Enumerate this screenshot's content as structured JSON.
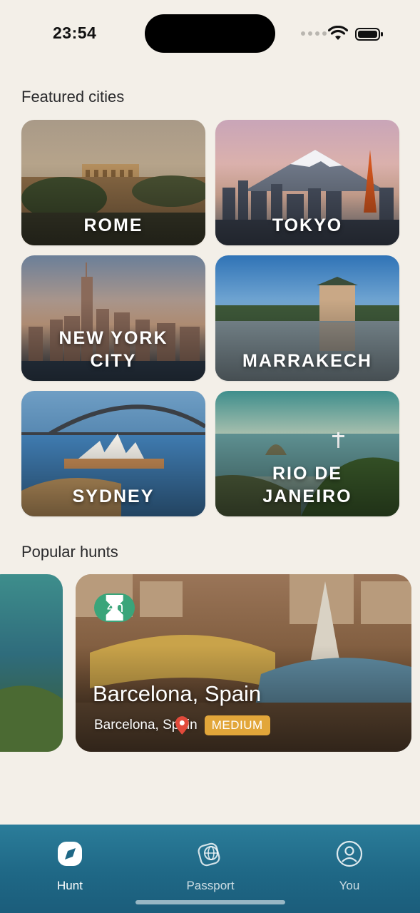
{
  "status": {
    "time": "23:54"
  },
  "sections": {
    "featured": "Featured cities",
    "popular": "Popular hunts"
  },
  "cities": [
    {
      "name": "ROME"
    },
    {
      "name": "TOKYO"
    },
    {
      "name": "NEW YORK CITY"
    },
    {
      "name": "MARRAKECH"
    },
    {
      "name": "SYDNEY"
    },
    {
      "name": "RIO DE JANEIRO"
    }
  ],
  "hunt": {
    "duration": "4h",
    "title": "Barcelona, Spain",
    "location": "Barcelona, Spain",
    "difficulty": "MEDIUM"
  },
  "tabs": [
    {
      "label": "Hunt",
      "icon": "compass-icon",
      "active": true
    },
    {
      "label": "Passport",
      "icon": "passport-globe-icon",
      "active": false
    },
    {
      "label": "You",
      "icon": "user-icon",
      "active": false
    }
  ],
  "colors": {
    "accent_green": "#3aa57a",
    "difficulty": "#e2a63a",
    "tabbar": "#1f6886",
    "background": "#f3efe8"
  }
}
